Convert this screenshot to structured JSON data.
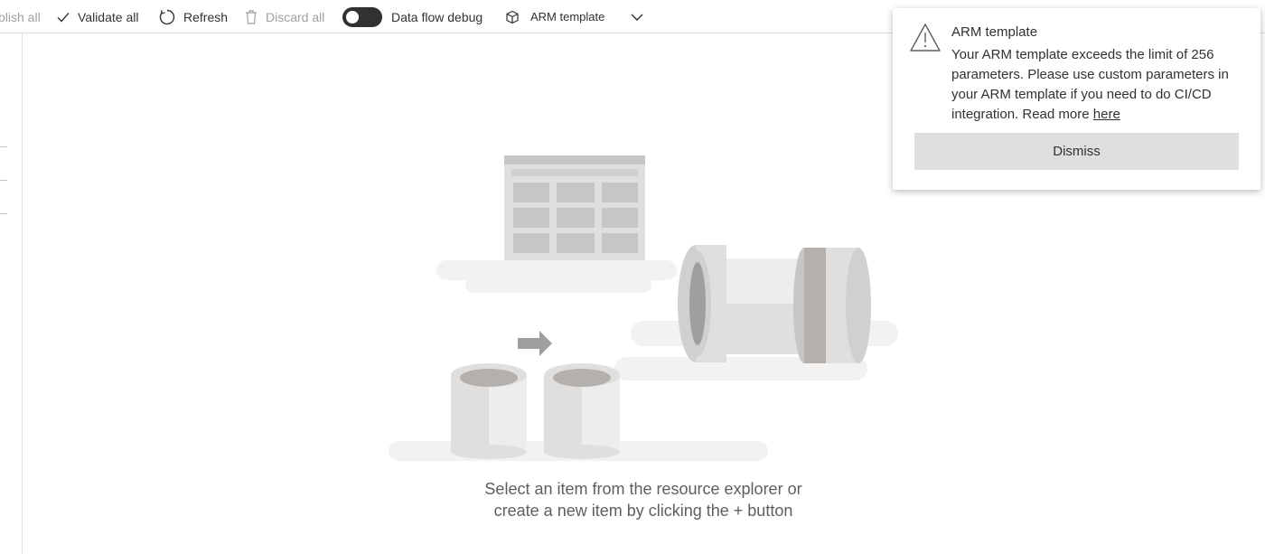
{
  "toolbar": {
    "publish_all": "blish all",
    "validate_all": "Validate all",
    "refresh": "Refresh",
    "discard_all": "Discard all",
    "data_flow_debug": "Data flow debug",
    "arm_template": "ARM template"
  },
  "empty_state": {
    "line1": "Select an item from the resource explorer or",
    "line2": "create a new item by clicking the + button"
  },
  "notification": {
    "title": "ARM template",
    "message": "Your ARM template exceeds the limit of 256 parameters. Please use custom parameters in your ARM template if you need to do CI/CD integration. Read more",
    "link_text": "here",
    "dismiss_label": "Dismiss"
  },
  "icons": {
    "validate": "checkmark-icon",
    "refresh": "refresh-icon",
    "discard": "trash-icon",
    "arm": "cube-icon",
    "dropdown": "chevron-down-icon",
    "warning": "warning-icon"
  },
  "colors": {
    "toggle_on": "#323130",
    "dismiss_bg": "#e1dfdd",
    "text_primary": "#323130",
    "text_disabled": "#a19f9d"
  }
}
